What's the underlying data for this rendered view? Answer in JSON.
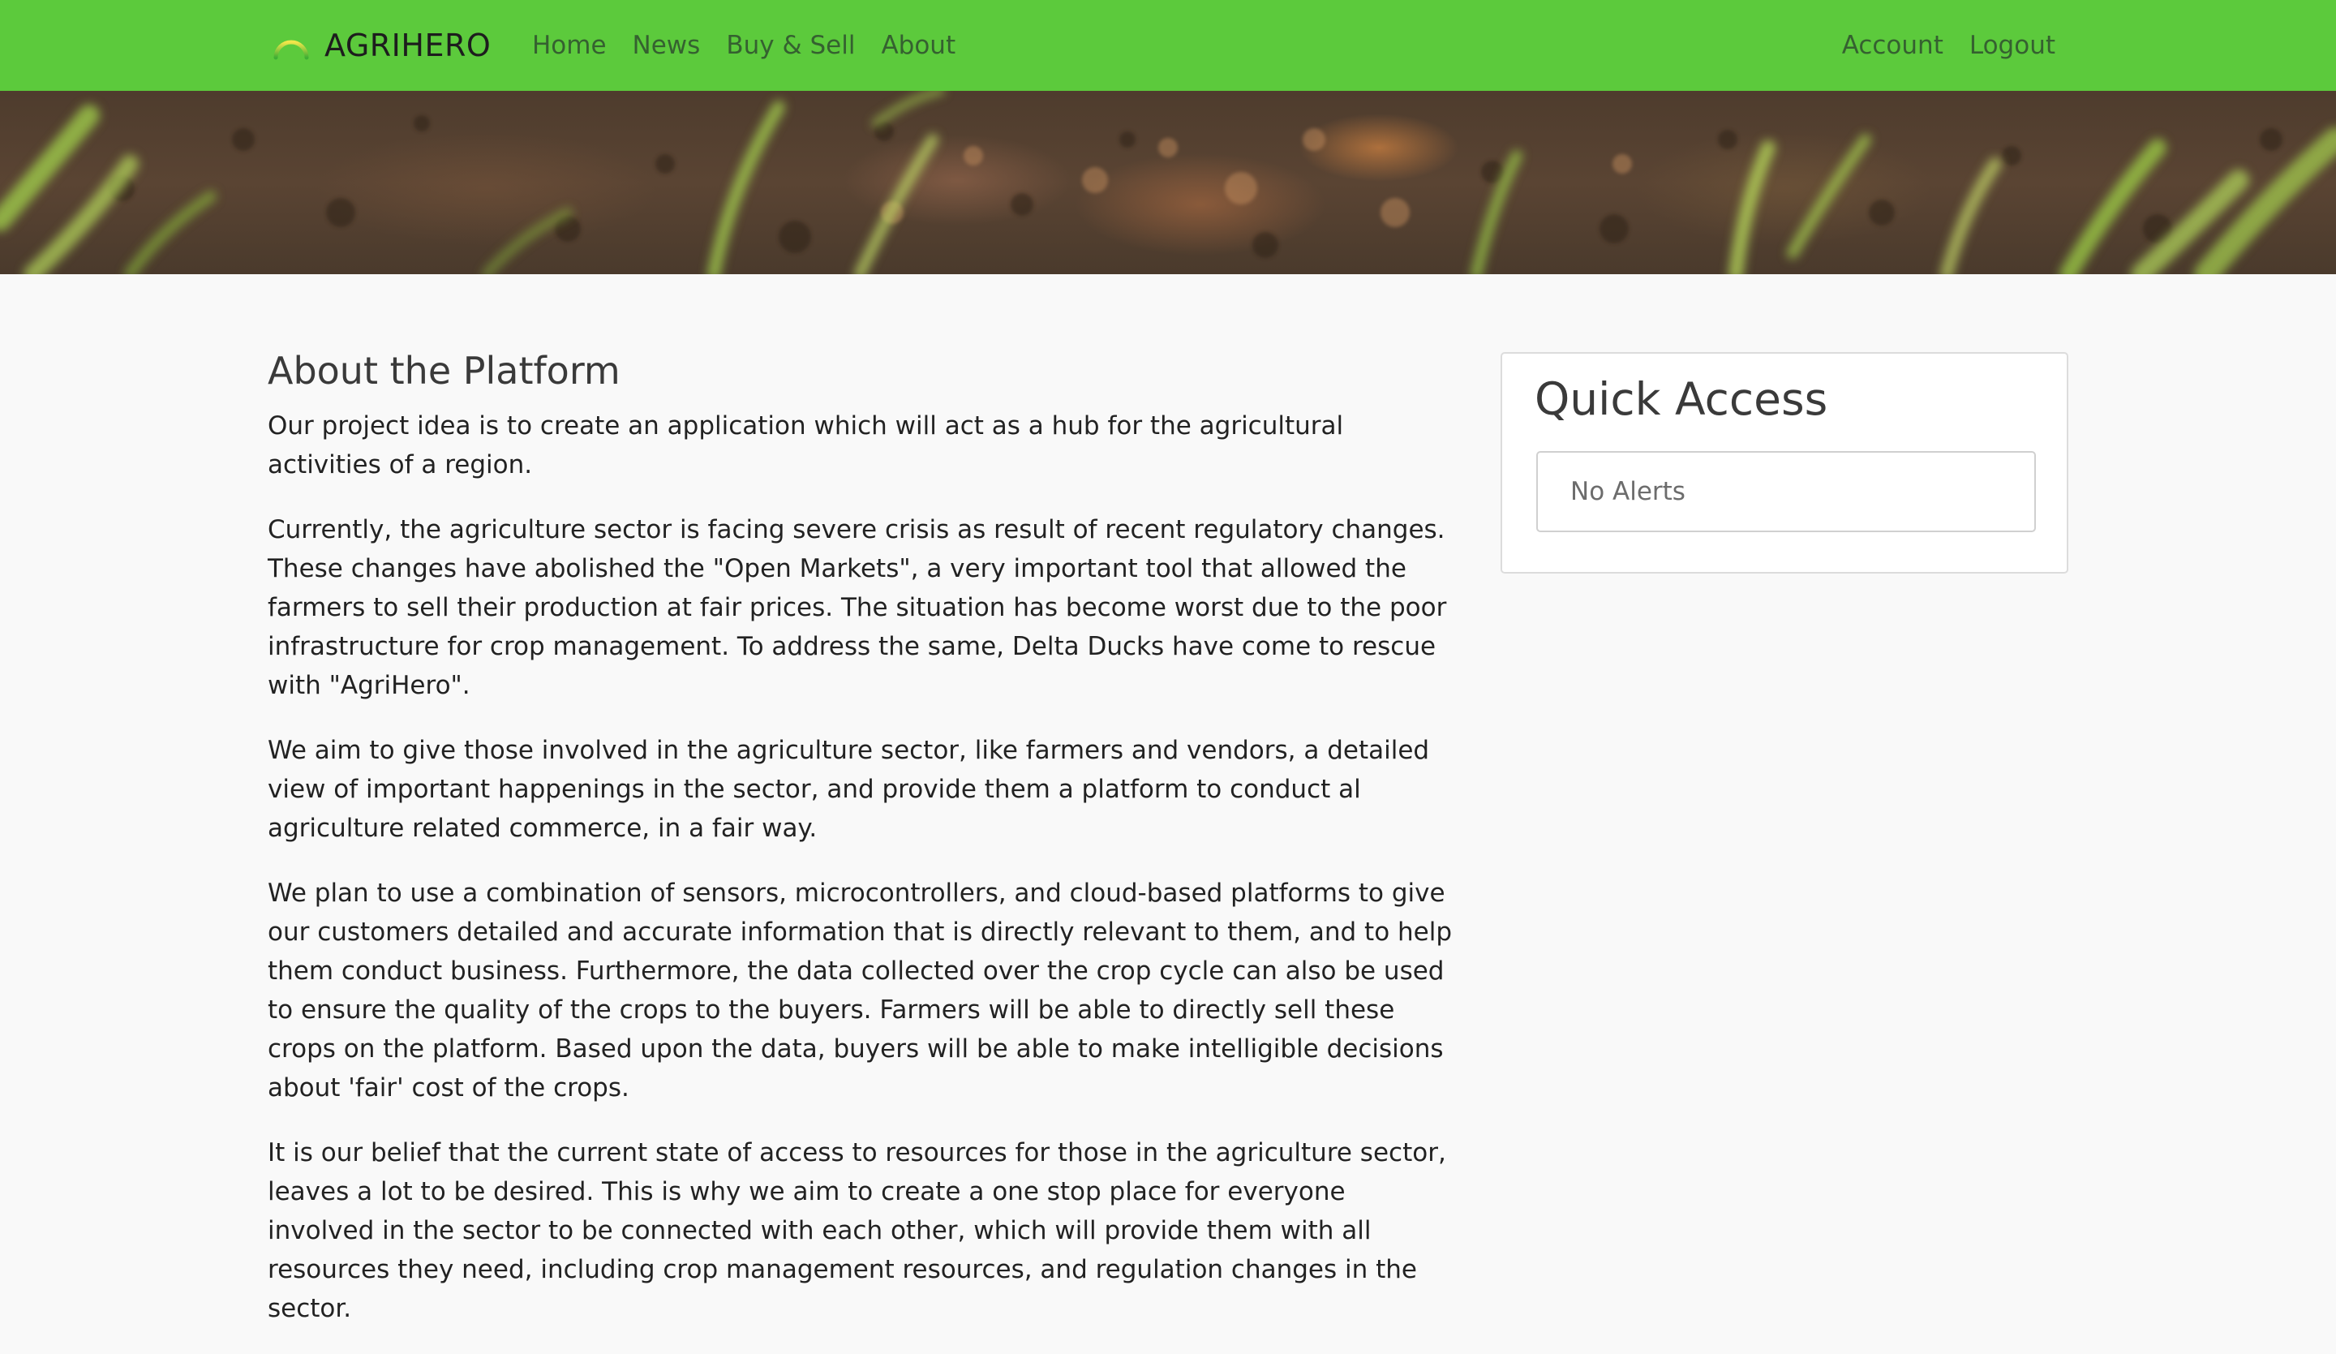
{
  "navbar": {
    "brand": "AGRIHERO",
    "links_left": [
      {
        "label": "Home"
      },
      {
        "label": "News"
      },
      {
        "label": "Buy & Sell"
      },
      {
        "label": "About"
      }
    ],
    "links_right": [
      {
        "label": "Account"
      },
      {
        "label": "Logout"
      }
    ]
  },
  "about": {
    "title": "About the Platform",
    "paragraphs": [
      "Our project idea is to create an application which will act as a hub for the agricultural activities of a region.",
      "Currently, the agriculture sector is facing severe crisis as result of recent regulatory changes. These changes have abolished the \"Open Markets\", a very important tool that allowed the farmers to sell their production at fair prices. The situation has become worst due to the poor infrastructure for crop management. To address the same, Delta Ducks have come to rescue with \"AgriHero\".",
      "We aim to give those involved in the agriculture sector, like farmers and vendors, a detailed view of important happenings in the sector, and provide them a platform to conduct al agriculture related commerce, in a fair way.",
      "We plan to use a combination of sensors, microcontrollers, and cloud-based platforms to give our customers detailed and accurate information that is directly relevant to them, and to help them conduct business. Furthermore, the data collected over the crop cycle can also be used to ensure the quality of the crops to the buyers. Farmers will be able to directly sell these crops on the platform. Based upon the data, buyers will be able to make intelligible decisions about 'fair' cost of the crops.",
      "It is our belief that the current state of access to resources for those in the agriculture sector, leaves a lot to be desired. This is why we aim to create a one stop place for everyone involved in the sector to be connected with each other, which will provide them with all resources they need, including crop management resources, and regulation changes in the sector."
    ]
  },
  "quick_access": {
    "title": "Quick Access",
    "alerts_text": "No Alerts"
  },
  "colors": {
    "navbar_bg": "#5cca3c",
    "page_bg": "#f9f9f9"
  }
}
